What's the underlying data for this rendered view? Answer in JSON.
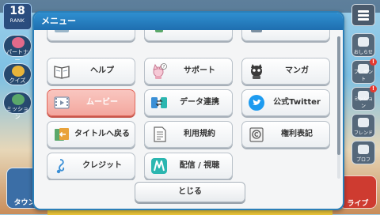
{
  "background": {
    "rank": {
      "number": "18",
      "label": "RANK"
    },
    "side_buttons": [
      {
        "label": "パートナー",
        "icon": "heart-icon",
        "color": "#e26a8a"
      },
      {
        "label": "クイズ",
        "icon": "quiz-icon",
        "color": "#e8b43a"
      },
      {
        "label": "ミッション",
        "icon": "mission-icon",
        "color": "#5aa86a"
      }
    ],
    "right_buttons": [
      {
        "label": "おしらせ",
        "icon": "mail-icon",
        "badge": ""
      },
      {
        "label": "プレゼント",
        "icon": "gift-icon",
        "badge": "!"
      },
      {
        "label": "ミッション",
        "icon": "mission-icon",
        "badge": "!"
      },
      {
        "label": "フレンド",
        "icon": "friend-icon",
        "badge": ""
      },
      {
        "label": "プロフ",
        "icon": "profile-icon",
        "badge": ""
      }
    ],
    "town_label": "タウン",
    "live_label": "ライブ"
  },
  "menu": {
    "title": "メニュー",
    "items": [
      {
        "label": "ヘルプ",
        "icon": "help-book-icon",
        "selected": false
      },
      {
        "label": "サポート",
        "icon": "support-character-icon",
        "selected": false
      },
      {
        "label": "マンガ",
        "icon": "manga-cat-icon",
        "selected": false
      },
      {
        "label": "ムービー",
        "icon": "movie-film-icon",
        "selected": true
      },
      {
        "label": "データ連携",
        "icon": "data-link-icon",
        "selected": false
      },
      {
        "label": "公式Twitter",
        "icon": "twitter-bird-icon",
        "selected": false
      },
      {
        "label": "タイトルへ戻る",
        "icon": "return-title-icon",
        "selected": false
      },
      {
        "label": "利用規約",
        "icon": "terms-document-icon",
        "selected": false
      },
      {
        "label": "権利表記",
        "icon": "copyright-icon",
        "selected": false
      },
      {
        "label": "クレジット",
        "icon": "credit-music-icon",
        "selected": false
      },
      {
        "label": "配信 / 視聴",
        "icon": "stream-m-icon",
        "selected": false
      }
    ],
    "close_label": "とじる"
  },
  "colors": {
    "header": "#1f6fb0",
    "selected_fill": "#f3a79e",
    "selected_border": "#e0685c",
    "twitter_blue": "#1d9bf0",
    "teal_icon": "#2bb6b0"
  }
}
